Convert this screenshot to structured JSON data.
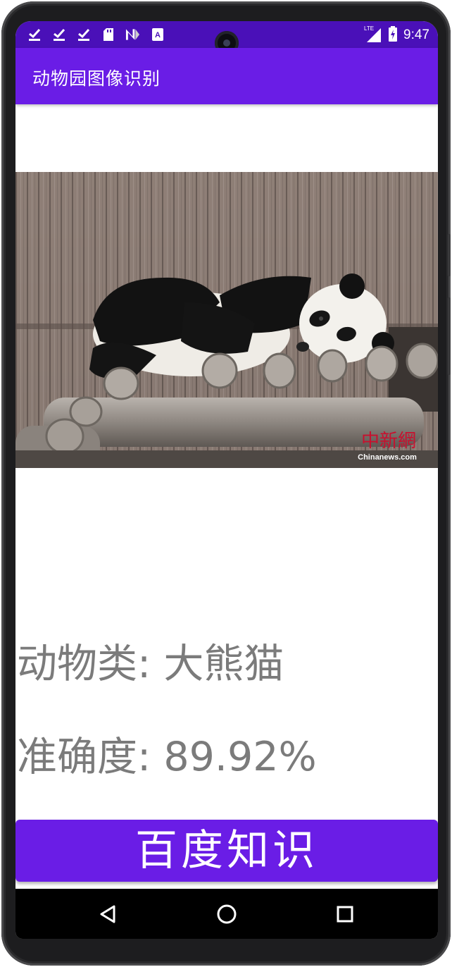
{
  "status_bar": {
    "time": "9:47",
    "network": "LTE",
    "notification_icons": [
      "check-icon",
      "check-icon",
      "check-icon",
      "sd-card-icon",
      "n-logo-icon",
      "a-box-icon"
    ]
  },
  "app_bar": {
    "title": "动物园图像识别"
  },
  "photo": {
    "subject": "giant panda lying on logs",
    "watermark_cn": "中新網",
    "watermark_en": "Chinanews.com"
  },
  "result": {
    "animal_text": "动物类: 大熊猫",
    "accuracy_text": "准确度: 89.92%"
  },
  "baike_button": {
    "label": "百度知识"
  },
  "nav_bar": {
    "buttons": [
      "back-icon",
      "home-icon",
      "recents-icon"
    ]
  },
  "colors": {
    "status_bar": "#4a10b8",
    "app_bar": "#6a1de6",
    "button": "#6a1de6",
    "result_text": "#7b7b7b"
  }
}
